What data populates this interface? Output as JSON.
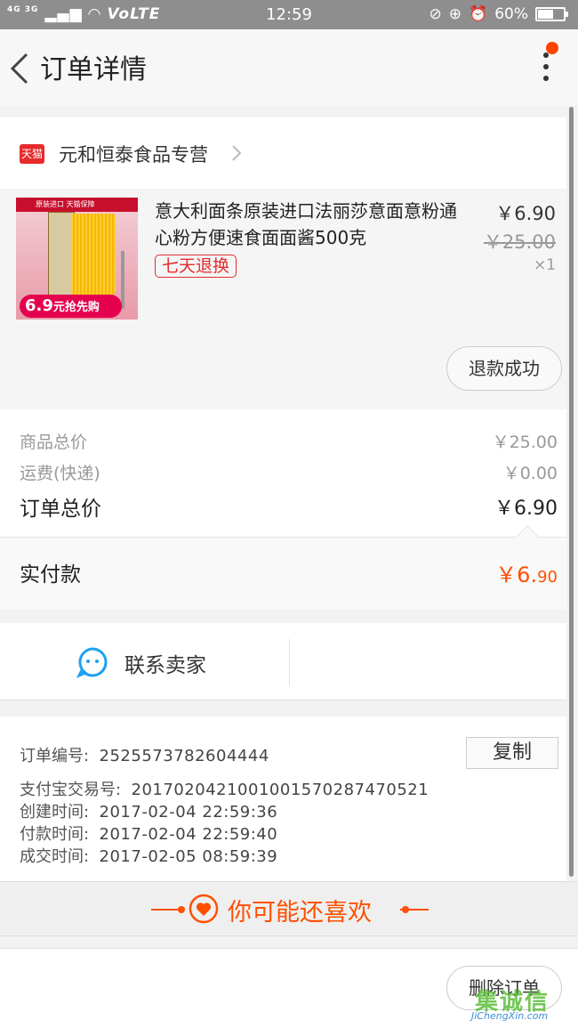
{
  "status_bar": {
    "network": "4G 3G",
    "volte": "VoLTE",
    "time": "12:59",
    "battery": "60%",
    "battery_level": 0.6
  },
  "nav": {
    "title": "订单详情",
    "back_icon": "chevron-left-icon",
    "more_icon": "vertical-dots-icon",
    "notice_color": "#ff4400"
  },
  "store": {
    "badge": "天猫",
    "name": "元和恒泰食品专营"
  },
  "product": {
    "title": "意大利面条原装进口法丽莎意面意粉通心粉方便速食面面酱500克",
    "return_tag": "七天退换",
    "price_now": "￥6.90",
    "price_old": "￥25.00",
    "qty": "×1",
    "refund_button": "退款成功",
    "thumbnail": {
      "header": "原装进口 天猫保障",
      "promo_price": "6.9",
      "promo_unit": "元",
      "promo_text": "抢先购"
    }
  },
  "summary": {
    "rows": [
      {
        "label": "商品总价",
        "value": "￥25.00"
      },
      {
        "label": "运费(快递)",
        "value": "￥0.00"
      },
      {
        "label": "订单总价",
        "value": "￥6.90"
      }
    ],
    "paid_label": "实付款",
    "paid_value_main": "￥6.",
    "paid_value_cents": "90",
    "accent": "#ff5000"
  },
  "contact": {
    "label": "联系卖家",
    "icon": "chat-bubble-icon",
    "icon_color": "#1da1f2"
  },
  "order_info": {
    "order_no_label": "订单编号:",
    "order_no": "2525573782604444",
    "copy_button": "复制",
    "alipay_label": "支付宝交易号:",
    "alipay_no": "2017020421001001570287470521",
    "created_label": "创建时间:",
    "created": "2017-02-04 22:59:36",
    "paid_label": "付款时间:",
    "paid": "2017-02-04 22:59:40",
    "deal_label": "成交时间:",
    "deal": "2017-02-05 08:59:39"
  },
  "recommend": {
    "title": "你可能还喜欢",
    "icon": "heart-icon"
  },
  "bottom": {
    "delete_button": "删除订单"
  },
  "watermark": {
    "logo": "集诚信",
    "text": "JiChengXin.com"
  }
}
